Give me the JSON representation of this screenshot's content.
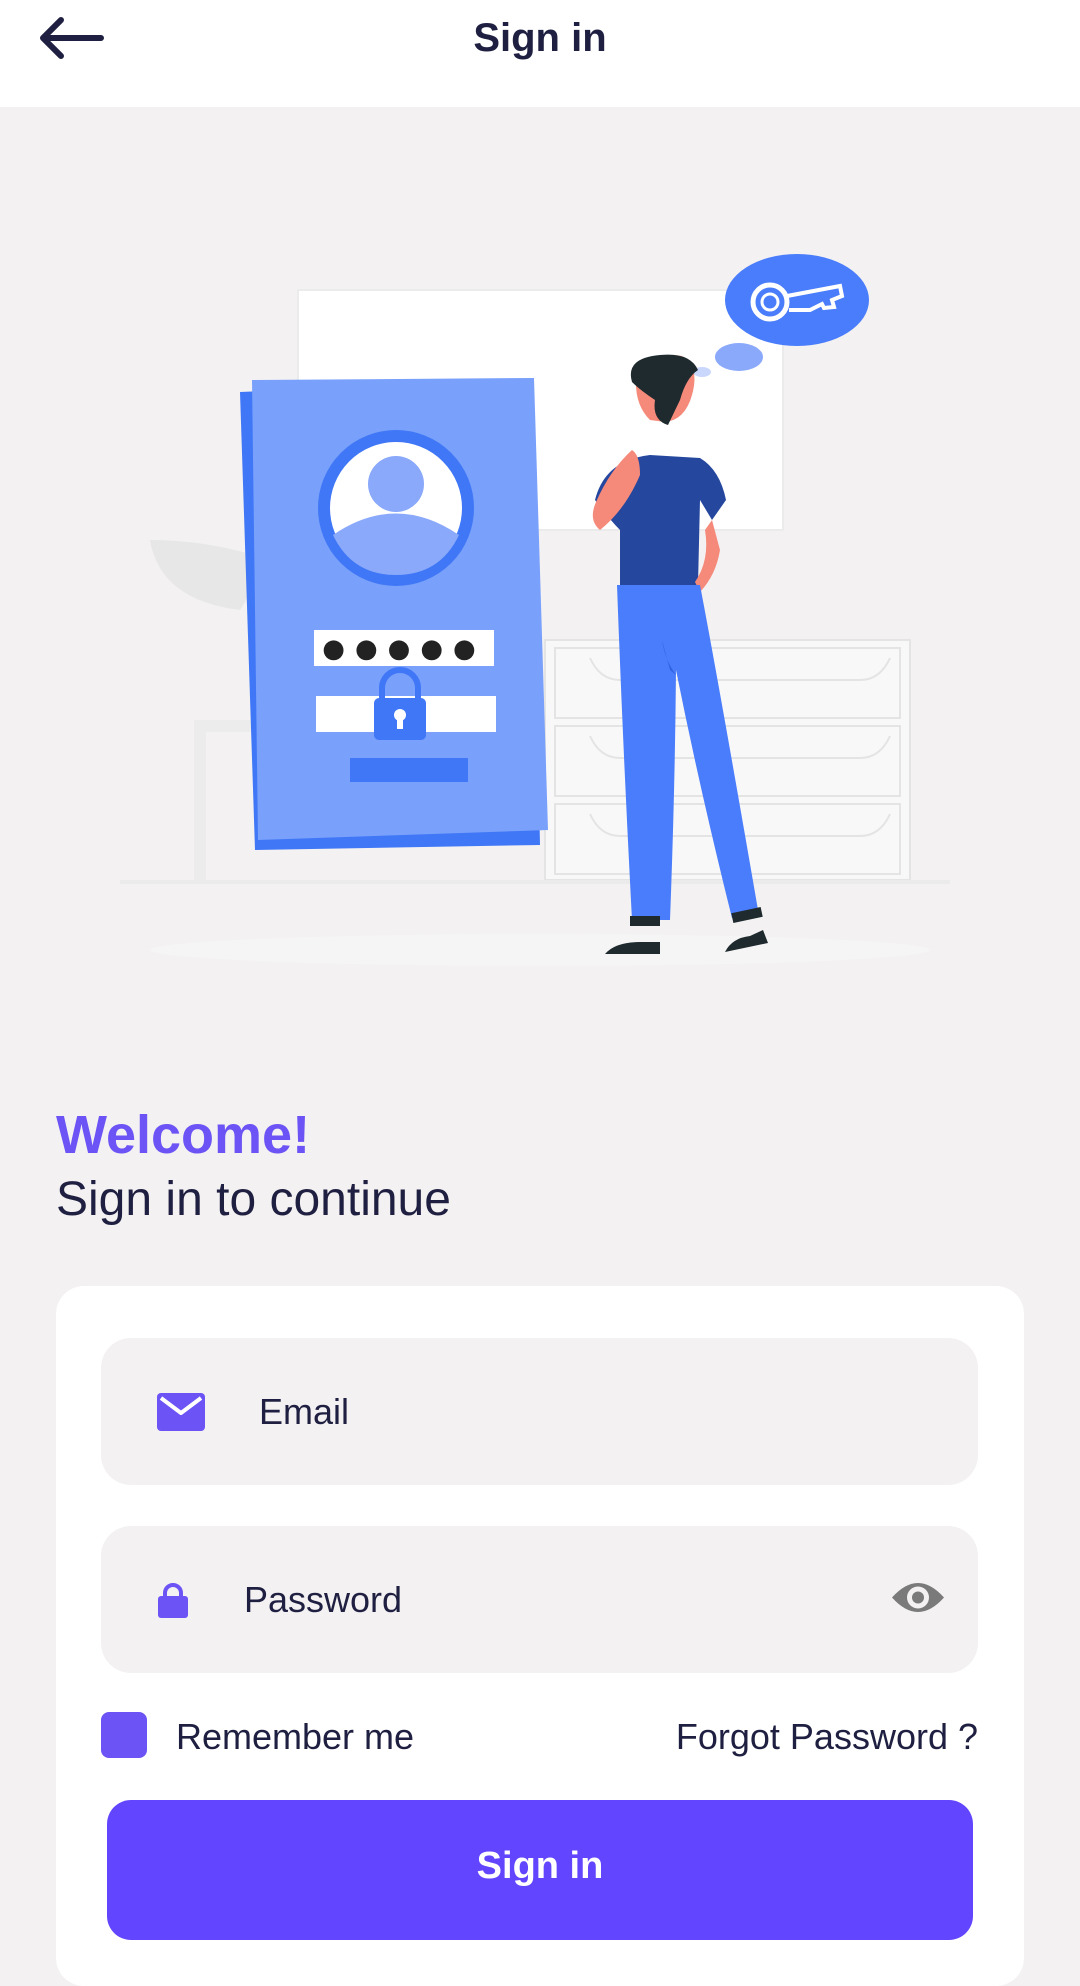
{
  "header": {
    "title": "Sign in",
    "back_icon": "arrow-left-icon"
  },
  "hero": {
    "illustration": "person-thinking-login-illustration",
    "password_dots": "●●●●●"
  },
  "welcome": {
    "title": "Welcome!",
    "subtitle": "Sign in to continue"
  },
  "form": {
    "email": {
      "placeholder": "Email",
      "value": "",
      "icon": "mail-icon"
    },
    "password": {
      "placeholder": "Password",
      "value": "",
      "icon": "lock-icon",
      "toggle_icon": "eye-icon"
    },
    "remember_label": "Remember me",
    "remember_checked": true,
    "forgot_label": "Forgot Password ?",
    "submit_label": "Sign in"
  },
  "colors": {
    "accent": "#6b53f5",
    "button": "#6246ff",
    "text": "#1f2041",
    "background": "#f3f1f2",
    "illustration_blue": "#4a7dfb"
  }
}
